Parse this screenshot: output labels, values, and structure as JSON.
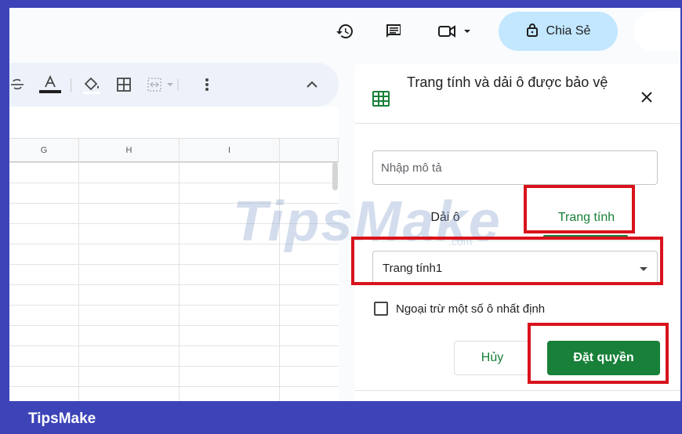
{
  "header": {
    "share_label": "Chia Sẻ",
    "icons": [
      "history-icon",
      "comment-icon",
      "video-call-icon",
      "lock-icon"
    ]
  },
  "toolbar": {
    "icons": [
      "strikethrough-icon",
      "text-color-icon",
      "fill-color-icon",
      "borders-icon",
      "merge-cells-icon",
      "more-options-icon",
      "collapse-icon"
    ]
  },
  "grid": {
    "columns": [
      "G",
      "H",
      "I"
    ]
  },
  "panel": {
    "title": "Trang tính và dải ô được bảo vệ",
    "description_placeholder": "Nhập mô tả",
    "tabs": [
      {
        "label": "Dải ô",
        "active": false
      },
      {
        "label": "Trang tính",
        "active": true
      }
    ],
    "selected_sheet": "Trang tính1",
    "except_label": "Ngoại trừ một số ô nhất định",
    "cancel_label": "Hủy",
    "set_permissions_label": "Đặt quyền"
  },
  "watermark": {
    "text": "TipsMake",
    "suffix": ".com"
  },
  "footer": {
    "brand": "TipsMake"
  },
  "colors": {
    "accent_green": "#188038",
    "highlight_red": "#d8131c",
    "footer_blue": "#3d44b8",
    "share_button_bg": "#c2e7ff"
  }
}
